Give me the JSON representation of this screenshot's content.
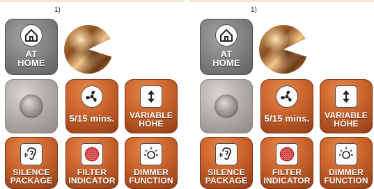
{
  "panels": [
    {
      "footnote": "1)",
      "at_home": {
        "line1": "AT",
        "line2": "HOME",
        "icon": "home-icon"
      },
      "timer": {
        "label": "5/15 mins.",
        "icon": "fan-icon"
      },
      "variable": {
        "line1": "VARIABLE",
        "line2": "HÖHE",
        "icon": "height-arrows-icon"
      },
      "silence": {
        "line1": "SILENCE",
        "line2": "PACKAGE",
        "icon": "ear-icon"
      },
      "filter": {
        "line1": "FILTER",
        "line2": "INDICATOR",
        "icon": "filter-grid-icon"
      },
      "dimmer": {
        "line1": "DIMMER",
        "line2": "FUNCTION",
        "icon": "light-bulb-icon"
      }
    },
    {
      "footnote": "1)",
      "at_home": {
        "line1": "AT",
        "line2": "HOME",
        "icon": "home-icon"
      },
      "timer": {
        "label": "5/15 mins.",
        "icon": "fan-icon"
      },
      "variable": {
        "line1": "VARIABLE",
        "line2": "HÖHE",
        "icon": "height-arrows-icon"
      },
      "silence": {
        "line1": "SILENCE",
        "line2": "PACKAGE",
        "icon": "ear-icon"
      },
      "filter": {
        "line1": "FILTER",
        "line2": "INDICATOR",
        "icon": "filter-grid-icon"
      },
      "dimmer": {
        "line1": "DIMMER",
        "line2": "FUNCTION",
        "icon": "light-bulb-icon"
      }
    }
  ],
  "colors": {
    "tile_orange": "#c8612b",
    "tile_grey": "#858688",
    "tile_stone": "#b3afac",
    "label_text": "#ffffff"
  }
}
